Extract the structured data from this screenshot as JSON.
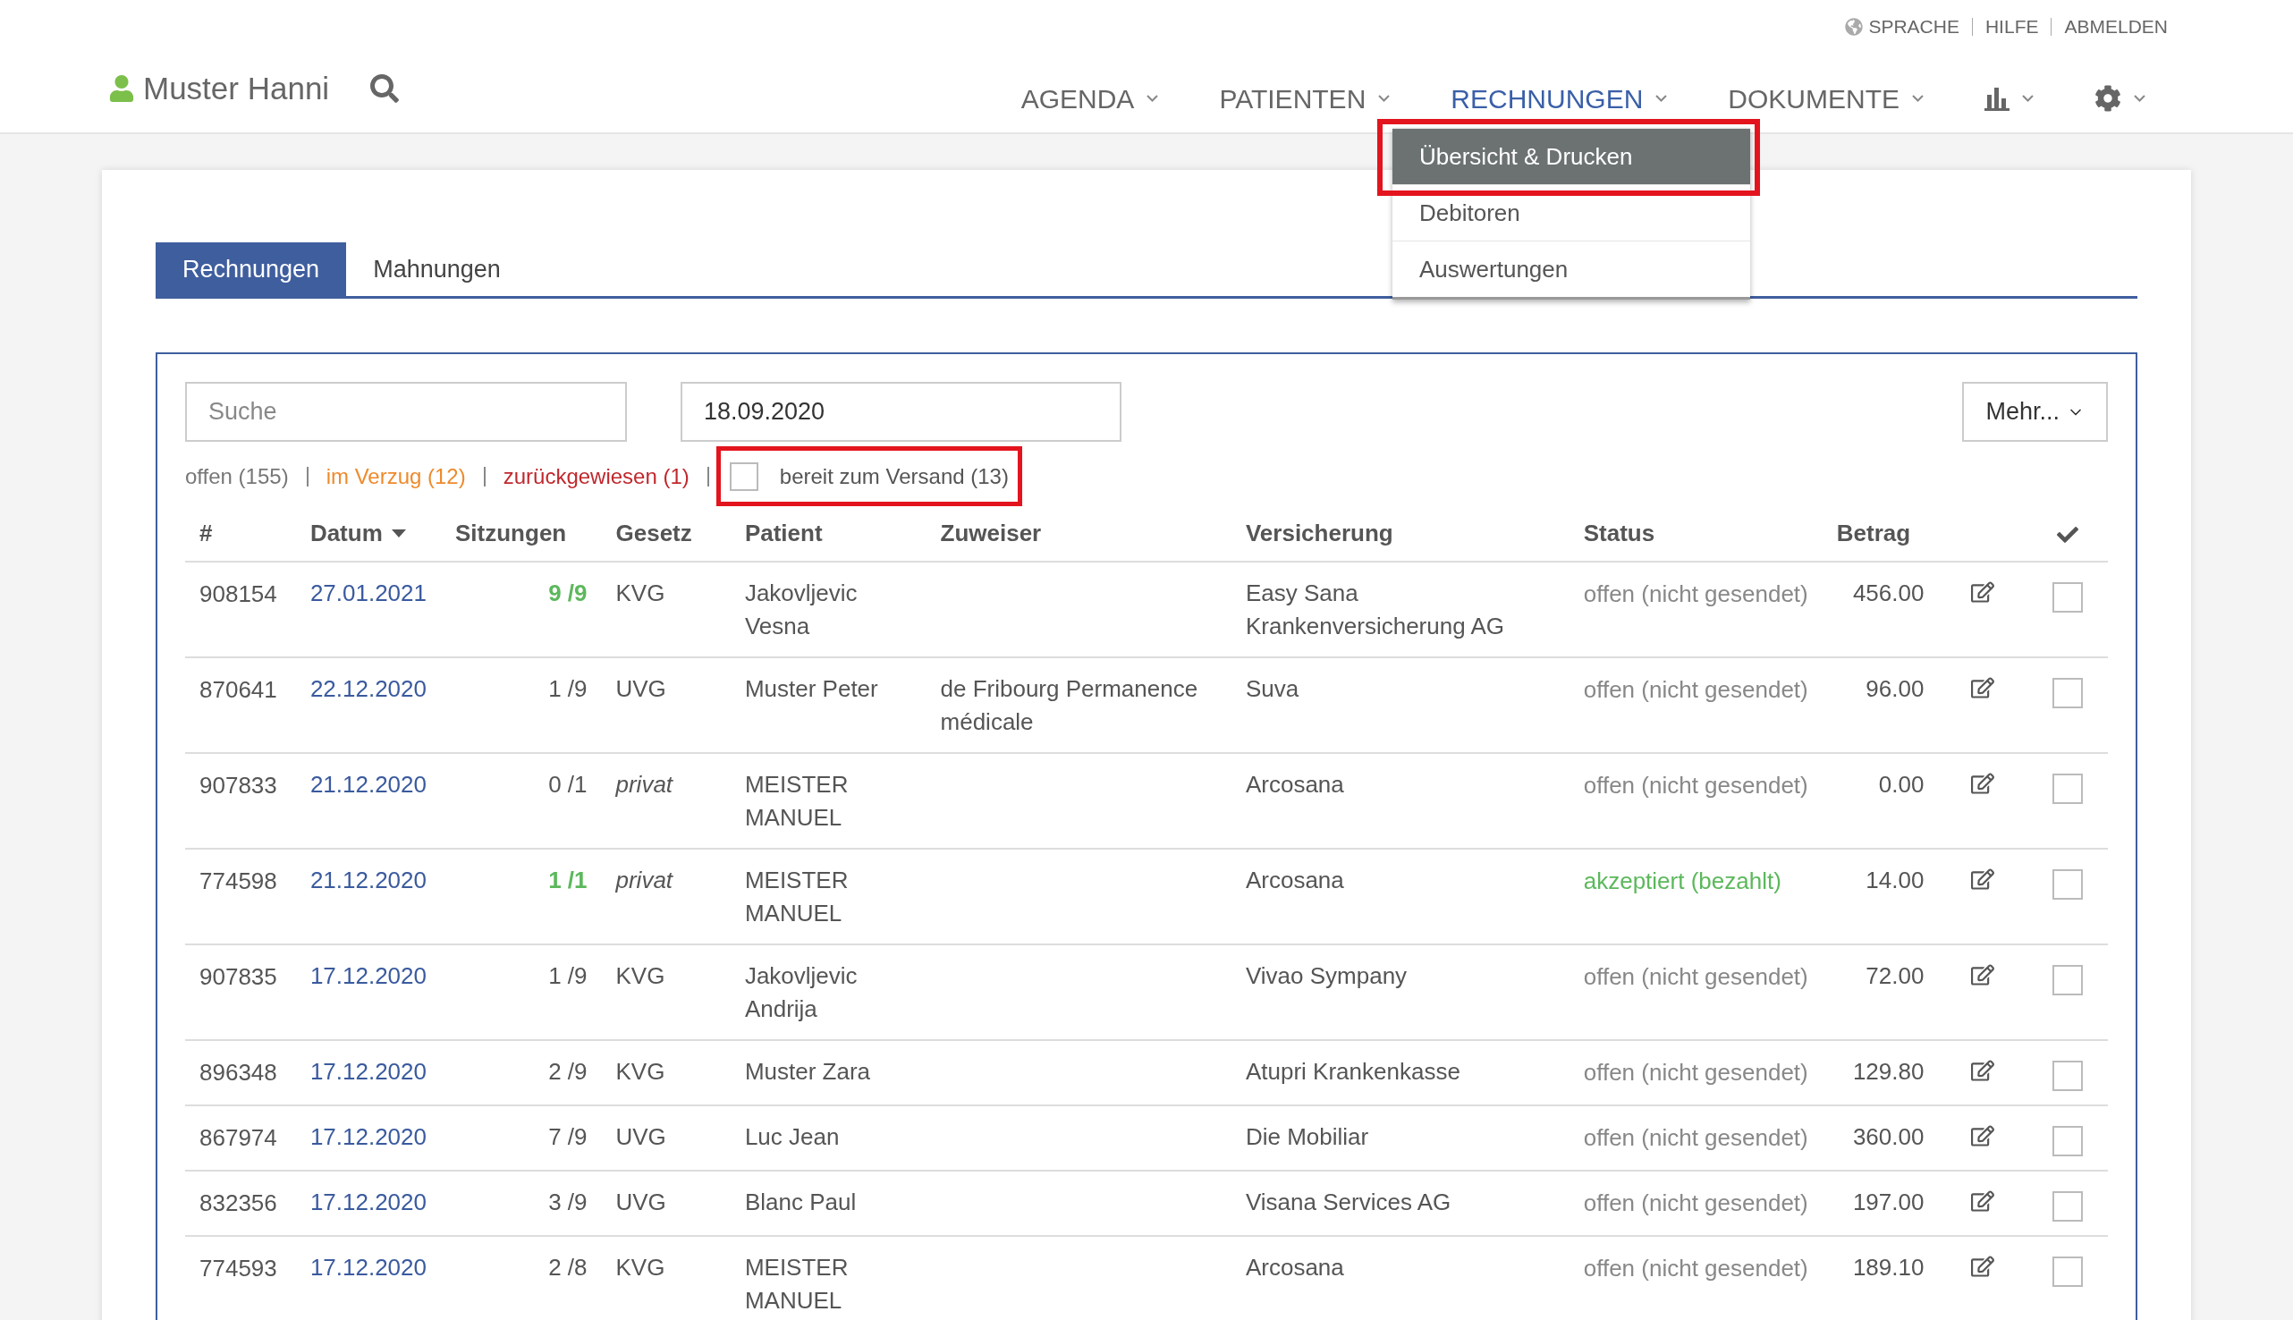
{
  "utility_links": [
    "SPRACHE",
    "HILFE",
    "ABMELDEN"
  ],
  "user": {
    "name": "Muster Hanni"
  },
  "nav": [
    {
      "kind": "text",
      "label": "AGENDA",
      "selected": false
    },
    {
      "kind": "text",
      "label": "PATIENTEN",
      "selected": false
    },
    {
      "kind": "text",
      "label": "RECHNUNGEN",
      "selected": true
    },
    {
      "kind": "text",
      "label": "DOKUMENTE",
      "selected": false
    },
    {
      "kind": "chart",
      "selected": false
    },
    {
      "kind": "settings",
      "selected": false
    }
  ],
  "dropdown": {
    "items": [
      {
        "label": "Übersicht & Drucken",
        "selected": true,
        "highlighted": true
      },
      {
        "label": "Debitoren",
        "selected": false,
        "highlighted": false
      },
      {
        "label": "Auswertungen",
        "selected": false,
        "highlighted": false
      }
    ]
  },
  "tabs": [
    {
      "label": "Rechnungen",
      "selected": true
    },
    {
      "label": "Mahnungen",
      "selected": false
    }
  ],
  "search": {
    "placeholder": "Suche"
  },
  "date_field": {
    "value": "18.09.2020"
  },
  "more_button": "Mehr...",
  "filters": [
    {
      "label": "offen (155)",
      "color": "#777777"
    },
    {
      "label": "im Verzug (12)",
      "color": "#ee8a2c"
    },
    {
      "label": "zurückgewiesen (1)",
      "color": "#c0282d"
    }
  ],
  "ready_filter": {
    "label": "bereit zum Versand (13)",
    "checked": false,
    "highlighted": true
  },
  "table": {
    "columns": [
      {
        "kind": "text",
        "label": "#"
      },
      {
        "kind": "sort",
        "label": "Datum"
      },
      {
        "kind": "text",
        "label": "Sitzungen"
      },
      {
        "kind": "text",
        "label": "Gesetz"
      },
      {
        "kind": "text",
        "label": "Patient"
      },
      {
        "kind": "text",
        "label": "Zuweiser"
      },
      {
        "kind": "text",
        "label": "Versicherung"
      },
      {
        "kind": "text",
        "label": "Status"
      },
      {
        "kind": "text",
        "label": "Betrag"
      },
      {
        "kind": "blank"
      },
      {
        "kind": "check"
      }
    ],
    "rows": [
      {
        "number": "908154",
        "date": "27.01.2021",
        "sessions": "9 /9",
        "complete": true,
        "law": "KVG",
        "law_italic": false,
        "patient": [
          "Jakovljevic",
          "Vesna"
        ],
        "referrer": [],
        "insurance": [
          "Easy Sana",
          "Krankenversicherung AG"
        ],
        "status": "offen (nicht gesendet)",
        "paid": false,
        "amount": "456.00",
        "checked": false
      },
      {
        "number": "870641",
        "date": "22.12.2020",
        "sessions": "1 /9",
        "complete": false,
        "law": "UVG",
        "law_italic": false,
        "patient": [
          "Muster Peter"
        ],
        "referrer": [
          "de Fribourg Permanence",
          "médicale"
        ],
        "insurance": [
          "Suva"
        ],
        "status": "offen (nicht gesendet)",
        "paid": false,
        "amount": "96.00",
        "checked": false
      },
      {
        "number": "907833",
        "date": "21.12.2020",
        "sessions": "0 /1",
        "complete": false,
        "law": "privat",
        "law_italic": true,
        "patient": [
          "MEISTER",
          "MANUEL"
        ],
        "referrer": [],
        "insurance": [
          "Arcosana"
        ],
        "status": "offen (nicht gesendet)",
        "paid": false,
        "amount": "0.00",
        "checked": false
      },
      {
        "number": "774598",
        "date": "21.12.2020",
        "sessions": "1 /1",
        "complete": true,
        "law": "privat",
        "law_italic": true,
        "patient": [
          "MEISTER",
          "MANUEL"
        ],
        "referrer": [],
        "insurance": [
          "Arcosana"
        ],
        "status": "akzeptiert (bezahlt)",
        "paid": true,
        "amount": "14.00",
        "checked": false
      },
      {
        "number": "907835",
        "date": "17.12.2020",
        "sessions": "1 /9",
        "complete": false,
        "law": "KVG",
        "law_italic": false,
        "patient": [
          "Jakovljevic",
          "Andrija"
        ],
        "referrer": [],
        "insurance": [
          "Vivao Sympany"
        ],
        "status": "offen (nicht gesendet)",
        "paid": false,
        "amount": "72.00",
        "checked": false
      },
      {
        "number": "896348",
        "date": "17.12.2020",
        "sessions": "2 /9",
        "complete": false,
        "law": "KVG",
        "law_italic": false,
        "patient": [
          "Muster Zara"
        ],
        "referrer": [],
        "insurance": [
          "Atupri Krankenkasse"
        ],
        "status": "offen (nicht gesendet)",
        "paid": false,
        "amount": "129.80",
        "checked": false
      },
      {
        "number": "867974",
        "date": "17.12.2020",
        "sessions": "7 /9",
        "complete": false,
        "law": "UVG",
        "law_italic": false,
        "patient": [
          "Luc Jean"
        ],
        "referrer": [],
        "insurance": [
          "Die Mobiliar"
        ],
        "status": "offen (nicht gesendet)",
        "paid": false,
        "amount": "360.00",
        "checked": false
      },
      {
        "number": "832356",
        "date": "17.12.2020",
        "sessions": "3 /9",
        "complete": false,
        "law": "UVG",
        "law_italic": false,
        "patient": [
          "Blanc Paul"
        ],
        "referrer": [],
        "insurance": [
          "Visana Services AG"
        ],
        "status": "offen (nicht gesendet)",
        "paid": false,
        "amount": "197.00",
        "checked": false
      },
      {
        "number": "774593",
        "date": "17.12.2020",
        "sessions": "2 /8",
        "complete": false,
        "law": "KVG",
        "law_italic": false,
        "patient": [
          "MEISTER",
          "MANUEL"
        ],
        "referrer": [],
        "insurance": [
          "Arcosana"
        ],
        "status": "offen (nicht gesendet)",
        "paid": false,
        "amount": "189.10",
        "checked": false
      }
    ]
  }
}
